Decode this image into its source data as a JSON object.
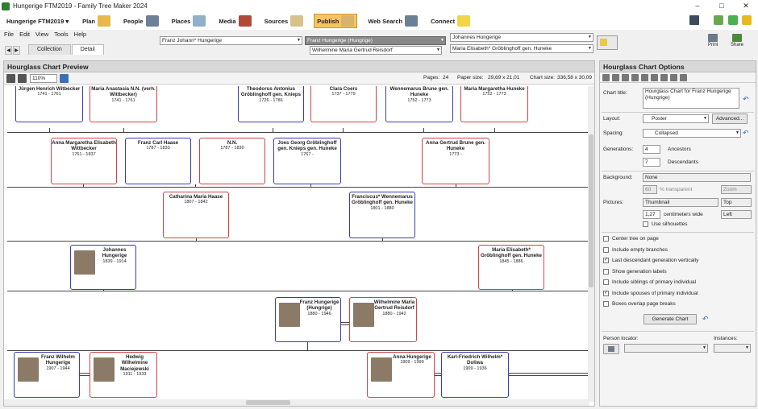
{
  "window": {
    "title": "Hungerige FTM2019 - Family Tree Maker 2024",
    "minimize": "–",
    "maximize": "□",
    "close": "✕"
  },
  "nav": {
    "tree": "Hungerige FTM2019 ▾",
    "items": [
      {
        "label": "Plan",
        "icon": "plan-icon",
        "color": "#e8b84a"
      },
      {
        "label": "People",
        "icon": "people-icon",
        "color": "#6d7f99"
      },
      {
        "label": "Places",
        "icon": "places-icon",
        "color": "#8fb0c8"
      },
      {
        "label": "Media",
        "icon": "media-icon",
        "color": "#b04a36"
      },
      {
        "label": "Sources",
        "icon": "sources-icon",
        "color": "#d8c28a"
      },
      {
        "label": "Publish",
        "icon": "publish-icon",
        "color": "#d9b26b"
      },
      {
        "label": "Web Search",
        "icon": "web-search-icon",
        "color": "#6b7f95"
      },
      {
        "label": "Connect",
        "icon": "connect-icon",
        "color": "#f2d447"
      }
    ]
  },
  "menu": [
    "File",
    "Edit",
    "View",
    "Tools",
    "Help"
  ],
  "tabs": [
    "Collection",
    "Detail"
  ],
  "family": {
    "primary": "Franz Johann* Hungerige",
    "spouse": "Franz Hungerige (Hungrige)",
    "other": "Wilhelmine Maria Gertrud Reisdorf",
    "father": "Johannes Hungerige",
    "mother": "Maria Elisabeth* Gröblinghoff gen. Huneke"
  },
  "top_actions": {
    "print": "Print",
    "share": "Share"
  },
  "preview": {
    "title": "Hourglass Chart Preview",
    "zoom": "110%",
    "pages_label": "Pages:",
    "pages": "24",
    "paper_label": "Paper size:",
    "paper": "29,69 x 21,01",
    "chart_label": "Chart size:",
    "chart": "336,58 x 30,09"
  },
  "people": [
    {
      "id": "p1",
      "name": "Jürgen Henrich Witbecker",
      "dates": "1741 - 1761",
      "sex": "m"
    },
    {
      "id": "p2",
      "name": "Maria Anastasia N.N. (verh. Wittbecker)",
      "dates": "1741 - 1761",
      "sex": "f"
    },
    {
      "id": "p3",
      "name": "Theodorus Antonius Gröblinghoff gen. Knieps",
      "dates": "1726 - 1786",
      "sex": "m"
    },
    {
      "id": "p4",
      "name": "Clara Coers",
      "dates": "1737 - 1779",
      "sex": "f"
    },
    {
      "id": "p5",
      "name": "Wennemarus Brune gen. Huneke",
      "dates": "1752 - 1773",
      "sex": "m"
    },
    {
      "id": "p6",
      "name": "Maria Margaretha Huneke",
      "dates": "1752 - 1773",
      "sex": "f"
    },
    {
      "id": "p7",
      "name": "Anna Margaretha Elisabeth Wittbecker",
      "dates": "1761 - 1837",
      "sex": "f"
    },
    {
      "id": "p8",
      "name": "Franz Carl Haase",
      "dates": "1787 - 1830",
      "sex": "m"
    },
    {
      "id": "p9",
      "name": "N.N.",
      "dates": "1787 - 1830",
      "sex": "f"
    },
    {
      "id": "p10",
      "name": "Joes Georg Gröblinghoff gen. Knieps gen. Huneke",
      "dates": "1767 -",
      "sex": "m"
    },
    {
      "id": "p11",
      "name": "Anna Gertrud Brune gen. Huneke",
      "dates": "1773 -",
      "sex": "f"
    },
    {
      "id": "p12",
      "name": "Catharina Maria Haase",
      "dates": "1807 - 1842",
      "sex": "f"
    },
    {
      "id": "p13",
      "name": "Franciscus* Wennemarus Gröblinghoff gen. Huneke",
      "dates": "1801 - 1880",
      "sex": "m"
    },
    {
      "id": "p14",
      "name": "Johannes Hungerige",
      "dates": "1839 - 1914",
      "sex": "m"
    },
    {
      "id": "p15",
      "name": "Maria Elisabeth* Gröblinghoff gen. Huneke",
      "dates": "1845 - 1886",
      "sex": "f"
    },
    {
      "id": "p16",
      "name": "Franz Hungerige (Hungrige)",
      "dates": "1880 - 1946",
      "sex": "m"
    },
    {
      "id": "p17",
      "name": "Wilhelmine Maria Gertrud Reisdorf",
      "dates": "1880 - 1942",
      "sex": "f"
    },
    {
      "id": "p18",
      "name": "Franz Wilhelm Hungerige",
      "dates": "1907 - 1944",
      "sex": "m"
    },
    {
      "id": "p19",
      "name": "Hedwig Wilhelmine Maciejewski",
      "dates": "1911 - 1933",
      "sex": "f"
    },
    {
      "id": "p20",
      "name": "Anna Hungerige",
      "dates": "1909 - 1999",
      "sex": "f"
    },
    {
      "id": "p21",
      "name": "Karl-Friedrich Wilhelm* Doliwa",
      "dates": "1909 - 1936",
      "sex": "m"
    }
  ],
  "options": {
    "title": "Hourglass Chart Options",
    "chart_title_label": "Chart title:",
    "chart_title": "Hourglass Chart for Franz Hungerige (Hungrige)",
    "layout_label": "Layout:",
    "layout": "Poster",
    "advanced": "Advanced...",
    "spacing_label": "Spacing:",
    "spacing": "Collapsed",
    "generations_label": "Generations:",
    "ancestors": "4",
    "ancestors_label": "Ancestors",
    "descendants": "7",
    "descendants_label": "Descendants",
    "background_label": "Background:",
    "background": "None",
    "transparency": "60",
    "transparent_label": "% transparent",
    "zoom": "Zoom",
    "pictures_label": "Pictures:",
    "pictures": "Thumbnail",
    "pic_pos": "Top",
    "pic_width": "1,27",
    "pic_width_label": "centimeters wide",
    "pic_align": "Left",
    "silhouettes": "Use silhouettes",
    "checks": [
      {
        "label": "Center tree on page",
        "checked": false
      },
      {
        "label": "Include empty branches",
        "checked": false
      },
      {
        "label": "Last descendant generation vertically",
        "checked": true
      },
      {
        "label": "Show generation labels",
        "checked": false
      },
      {
        "label": "Include siblings of primary individual",
        "checked": false
      },
      {
        "label": "Include spouses of primary individual",
        "checked": true
      },
      {
        "label": "Boxes overlap page breaks",
        "checked": false
      }
    ],
    "generate": "Generate Chart",
    "locator_label": "Person locator:",
    "instances_label": "Instances:"
  }
}
